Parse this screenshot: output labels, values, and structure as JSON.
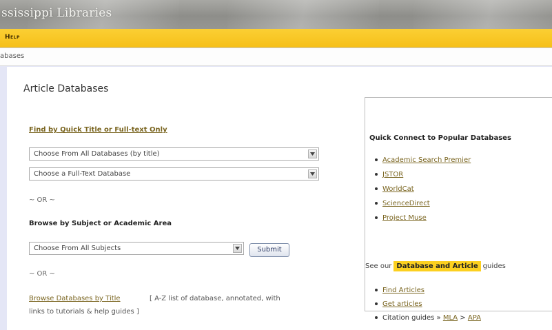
{
  "banner": {
    "title": "ssissippi Libraries"
  },
  "nav": {
    "help_label": "Help"
  },
  "breadcrumb": {
    "current": "abases"
  },
  "main": {
    "heading": "Article Databases",
    "quick_find": {
      "link_label": "Find by Quick Title or Full-text Only",
      "select_all_db": "Choose From All Databases (by title)",
      "select_fulltext": "Choose a Full-Text Database"
    },
    "or_label": "~ OR ~",
    "browse_subject": {
      "title": "Browse by Subject or Academic Area",
      "select_subjects": "Choose From All Subjects",
      "submit_label": "Submit"
    },
    "browse_title": {
      "link_label": "Browse Databases by Title",
      "description_line1": "[ A-Z list of database, annotated, with",
      "description_line2": "links to tutorials & help guides ]"
    }
  },
  "quick_connect": {
    "title": "Quick Connect to Popular Databases",
    "items": [
      "Academic Search Premier",
      "JSTOR",
      "WorldCat",
      "ScienceDirect",
      "Project Muse"
    ],
    "see_our_prefix": "See our",
    "guides_highlight": "Database and Article",
    "see_our_suffix": "guides",
    "guide_links": [
      "Find Articles",
      "Get articles"
    ],
    "citation_prefix": "Citation guides »",
    "citation_mla": "MLA",
    "citation_sep": ">",
    "citation_apa": "APA"
  },
  "colors": {
    "nav_yellow": "#f6c01a",
    "link_brown": "#7a6520",
    "highlight_yellow": "#fcd020",
    "page_border": "#e4e6f6"
  }
}
